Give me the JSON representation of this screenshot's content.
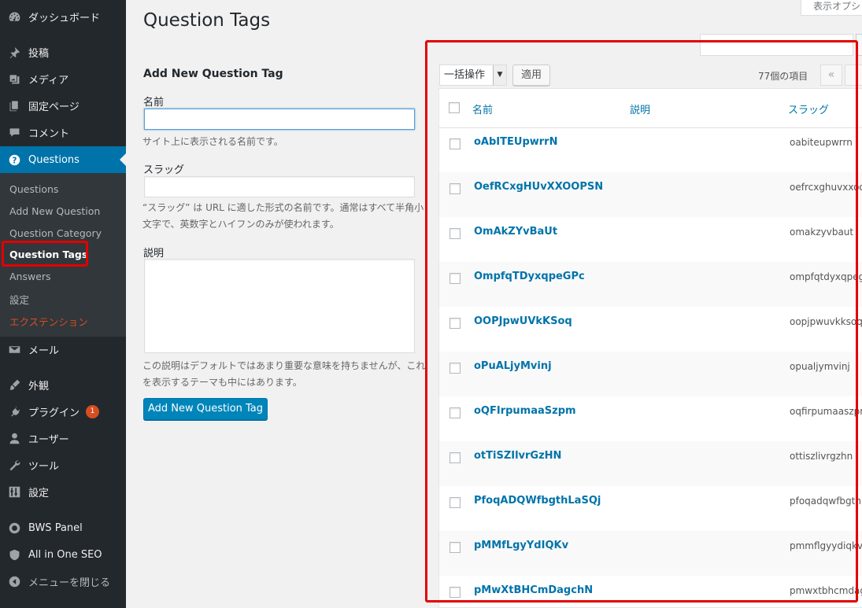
{
  "sidebar": {
    "menu": [
      {
        "label": "ダッシュボード",
        "icon": "dashboard-icon"
      },
      {
        "label": "投稿",
        "icon": "pin-icon"
      },
      {
        "label": "メディア",
        "icon": "media-icon"
      },
      {
        "label": "固定ページ",
        "icon": "page-icon"
      },
      {
        "label": "コメント",
        "icon": "comment-icon"
      },
      {
        "label": "Questions",
        "icon": "question-icon"
      },
      {
        "label": "メール",
        "icon": "mail-icon"
      },
      {
        "label": "外観",
        "icon": "brush-icon"
      },
      {
        "label": "プラグイン",
        "icon": "plugin-icon",
        "badge": "1"
      },
      {
        "label": "ユーザー",
        "icon": "user-icon"
      },
      {
        "label": "ツール",
        "icon": "wrench-icon"
      },
      {
        "label": "設定",
        "icon": "settings-icon"
      },
      {
        "label": "BWS Panel",
        "icon": "bws-icon"
      },
      {
        "label": "All in One SEO",
        "icon": "shield-icon"
      },
      {
        "label": "メニューを閉じる",
        "icon": "collapse-icon"
      }
    ],
    "submenu": [
      "Questions",
      "Add New Question",
      "Question Category",
      "Question Tags",
      "Answers",
      "設定",
      "エクステンション"
    ]
  },
  "header": {
    "title": "Question Tags",
    "screen_options": "表示オプション"
  },
  "form": {
    "heading": "Add New Question Tag",
    "name_label": "名前",
    "name_value": "",
    "name_help": "サイト上に表示される名前です。",
    "slug_label": "スラッグ",
    "slug_value": "",
    "slug_help_1": "“スラッグ” は URL に適した形式の名前です。通常はすべて半角小",
    "slug_help_2": "文字で、英数字とハイフンのみが使われます。",
    "desc_label": "説明",
    "desc_value": "",
    "desc_help_1": "この説明はデフォルトではあまり重要な意味を持ちませんが、これ",
    "desc_help_2": "を表示するテーマも中にはあります。",
    "submit_label": "Add New Question Tag"
  },
  "list": {
    "bulk_action": "一括操作",
    "apply_label": "適用",
    "items_count": "77個の項目",
    "prev_page": "«",
    "columns": {
      "name": "名前",
      "description": "説明",
      "slug": "スラッグ"
    },
    "rows": [
      {
        "name": "oAbITEUpwrrN",
        "slug": "oabiteupwrrn"
      },
      {
        "name": "OefRCxgHUvXXOOPSN",
        "slug": "oefrcxghuvxxoo"
      },
      {
        "name": "OmAkZYvBaUt",
        "slug": "omakzyvbaut"
      },
      {
        "name": "OmpfqTDyxqpeGPc",
        "slug": "ompfqtdyxqpeg"
      },
      {
        "name": "OOPJpwUVkKSoq",
        "slug": "oopjpwuvkksoq"
      },
      {
        "name": "oPuALjyMvinj",
        "slug": "opualjymvinj"
      },
      {
        "name": "oQFIrpumaaSzpm",
        "slug": "oqfirpumaaszpr"
      },
      {
        "name": "otTiSZIlvrGzHN",
        "slug": "ottiszlivrgzhn"
      },
      {
        "name": "PfoqADQWfbgthLaSQj",
        "slug": "pfoqadqwfbgth"
      },
      {
        "name": "pMMfLgyYdIQKv",
        "slug": "pmmflgyydiqkv"
      },
      {
        "name": "pMwXtBHCmDagchN",
        "slug": "pmwxtbhcmdag"
      }
    ]
  },
  "colors": {
    "sidebar_bg": "#23282d",
    "submenu_bg": "#32373c",
    "active": "#0073aa",
    "link": "#0073aa",
    "primary_button": "#0085ba",
    "highlight": "#e30000",
    "extension_orange": "#d54e21"
  }
}
